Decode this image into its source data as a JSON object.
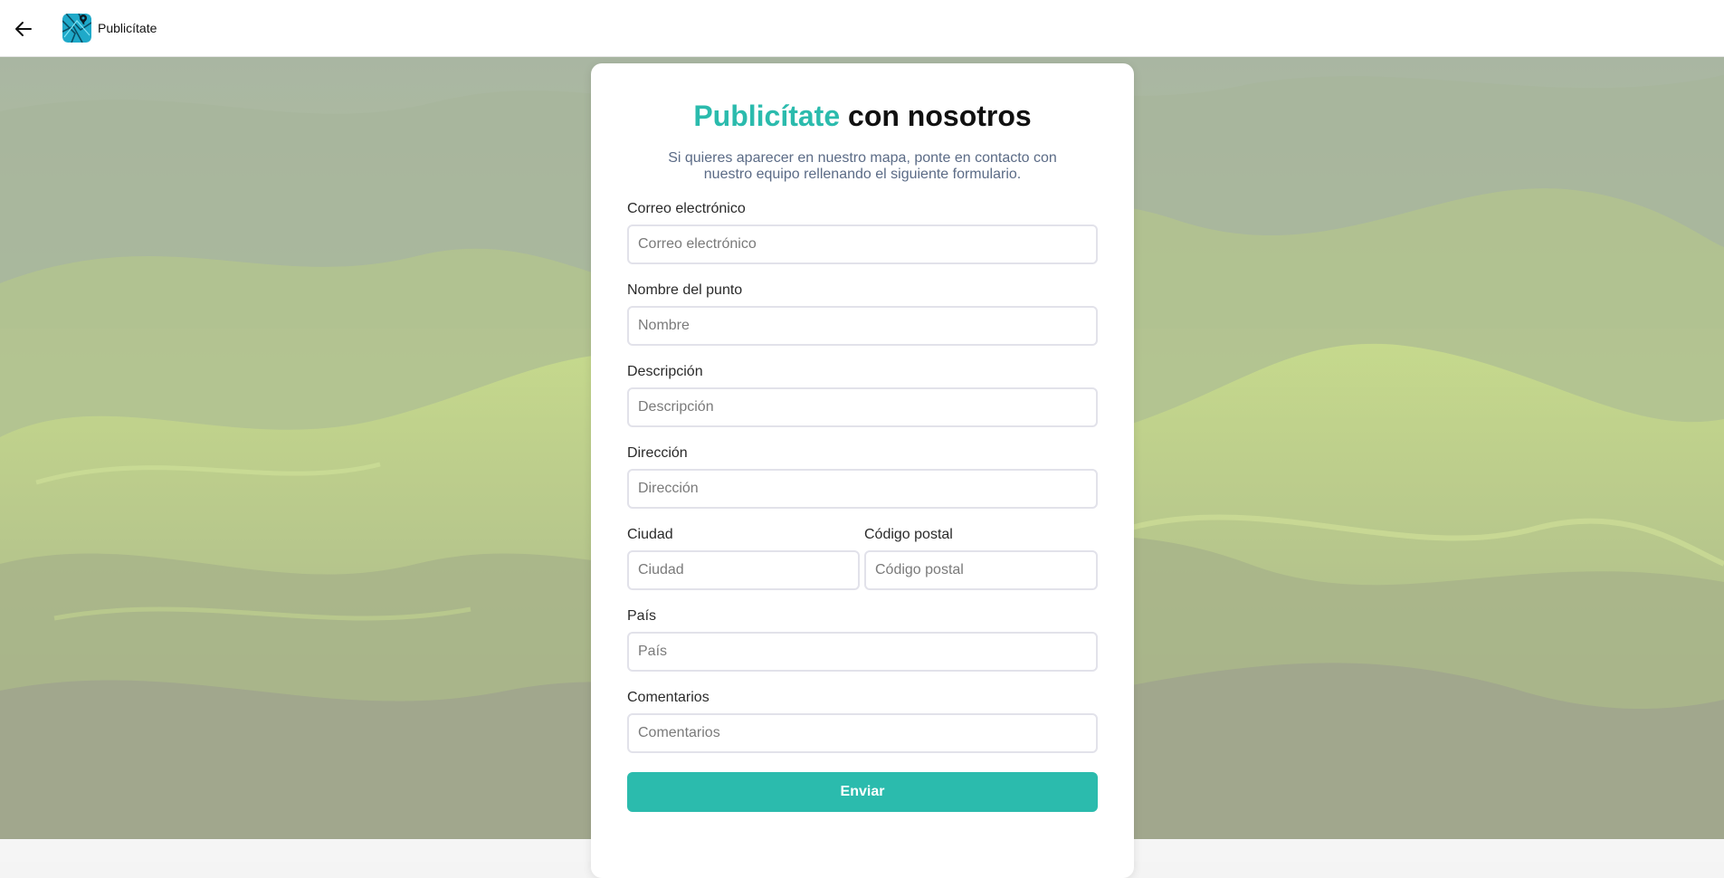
{
  "header": {
    "back_icon": "arrow-left-icon",
    "logo_icon": "map-pin-logo-icon",
    "app_title": "Publicítate"
  },
  "form": {
    "title_accent": "Publicítate",
    "title_rest": " con nosotros",
    "subtitle": "Si quieres aparecer en nuestro mapa, ponte en contacto con nuestro equipo rellenando el siguiente formulario.",
    "fields": [
      {
        "label": "Correo electrónico",
        "placeholder": "Correo electrónico",
        "value": ""
      },
      {
        "label": "Nombre del punto",
        "placeholder": "Nombre",
        "value": ""
      },
      {
        "label": "Descripción",
        "placeholder": "Descripción",
        "value": ""
      },
      {
        "label": "Dirección",
        "placeholder": "Dirección",
        "value": ""
      },
      {
        "label": "Ciudad",
        "placeholder": "Ciudad",
        "value": ""
      },
      {
        "label": "Código postal",
        "placeholder": "Código postal",
        "value": ""
      },
      {
        "label": "País",
        "placeholder": "País",
        "value": ""
      },
      {
        "label": "Comentarios",
        "placeholder": "Comentarios",
        "value": ""
      }
    ],
    "submit_label": "Enviar"
  },
  "colors": {
    "accent": "#2bbbad",
    "subtitle": "#5b6b86",
    "input_border": "#e2e2ea"
  }
}
